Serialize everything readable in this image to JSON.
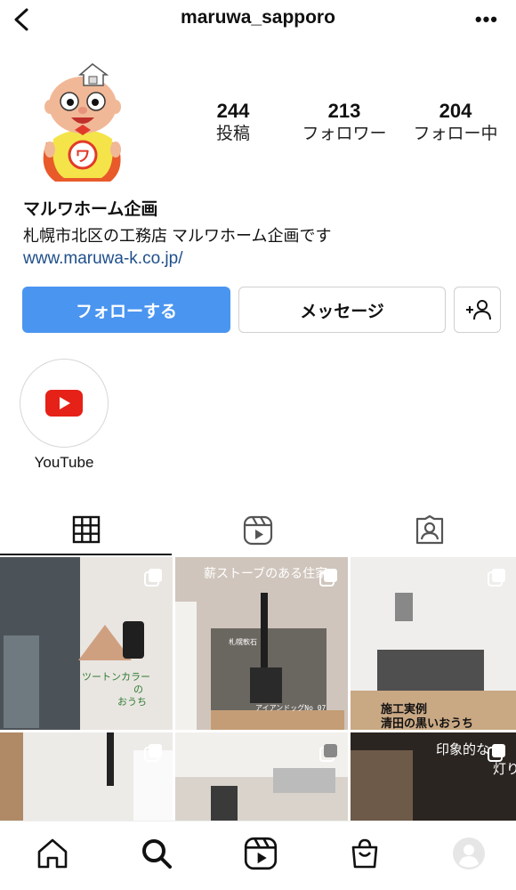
{
  "header": {
    "username": "maruwa_sapporo"
  },
  "stats": [
    {
      "value": "244",
      "label": "投稿"
    },
    {
      "value": "213",
      "label": "フォロワー"
    },
    {
      "value": "204",
      "label": "フォロー中"
    }
  ],
  "profile": {
    "name": "マルワホーム企画",
    "bio": "札幌市北区の工務店 マルワホーム企画です",
    "link": "www.maruwa-k.co.jp/"
  },
  "buttons": {
    "follow": "フォローする",
    "message": "メッセージ"
  },
  "highlight": {
    "label": "YouTube"
  },
  "posts": [
    {
      "text1": "ツートンカラー",
      "text2": "の",
      "text3": "おうち"
    },
    {
      "text1": "薪ストーブのある住家",
      "text2": "札幌軟石",
      "text3": "アイアンドッグNo 07"
    },
    {
      "text1": "施工実例",
      "text2": "清田の黒いおうち"
    },
    {},
    {},
    {
      "text1": "印象的な",
      "text2": "灯り"
    }
  ],
  "icons": {
    "back": "chevron-left-icon",
    "more": "more-icon",
    "add_user": "add-user-icon",
    "youtube": "youtube-icon",
    "grid": "grid-icon",
    "reels": "reels-icon",
    "tagged": "tagged-icon",
    "home": "home-icon",
    "search": "search-icon",
    "shop": "shop-icon",
    "profile": "profile-icon"
  },
  "colors": {
    "accent": "#4a95f0",
    "link": "#1f4f8b",
    "youtube": "#e62117"
  }
}
